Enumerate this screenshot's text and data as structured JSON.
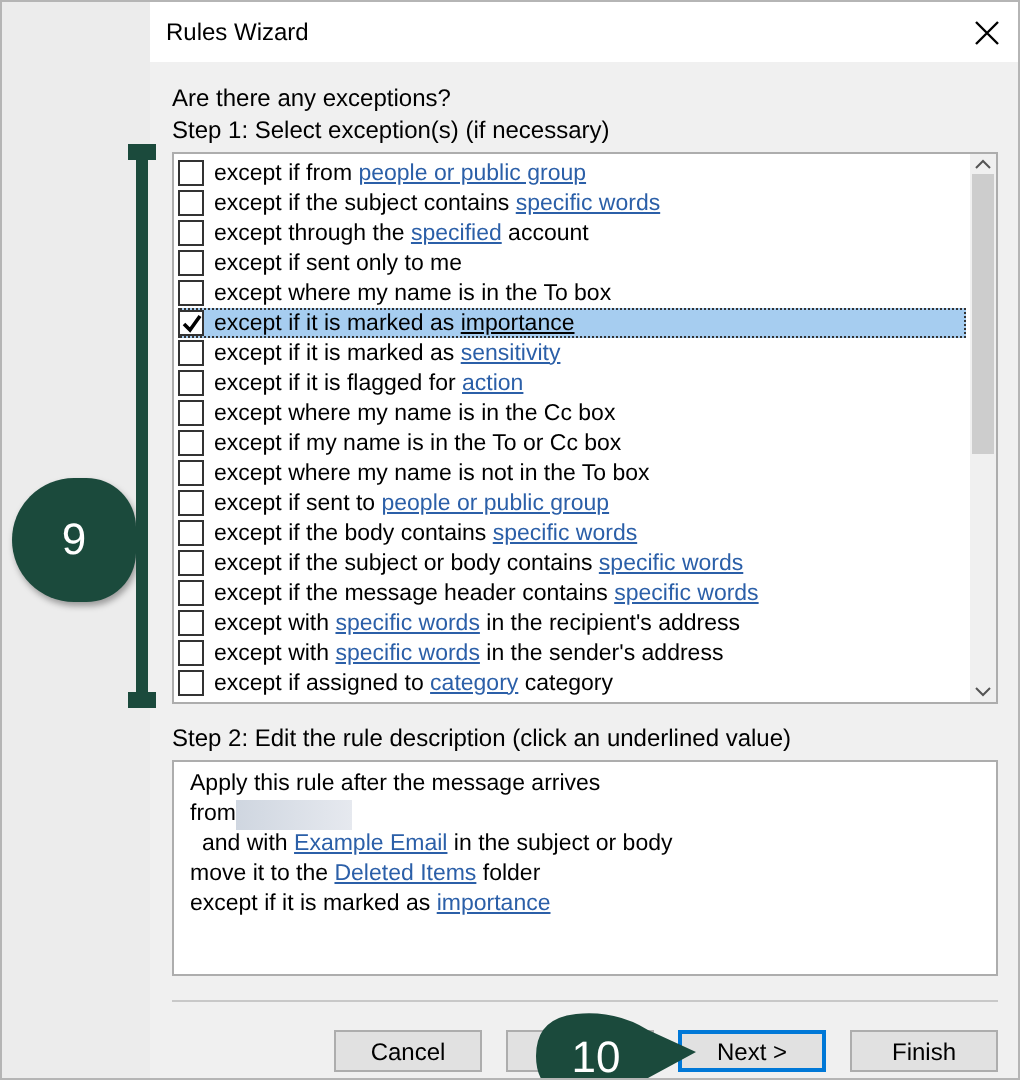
{
  "window": {
    "title": "Rules Wizard"
  },
  "question": "Are there any exceptions?",
  "step1_label": "Step 1: Select exception(s) (if necessary)",
  "exceptions": [
    {
      "checked": false,
      "selected": false,
      "parts": [
        {
          "kind": "text",
          "text": "except if from "
        },
        {
          "kind": "link",
          "text": "people or public group"
        }
      ]
    },
    {
      "checked": false,
      "selected": false,
      "parts": [
        {
          "kind": "text",
          "text": "except if the subject contains "
        },
        {
          "kind": "link",
          "text": "specific words"
        }
      ]
    },
    {
      "checked": false,
      "selected": false,
      "parts": [
        {
          "kind": "text",
          "text": "except through the "
        },
        {
          "kind": "link",
          "text": "specified"
        },
        {
          "kind": "text",
          "text": " account"
        }
      ]
    },
    {
      "checked": false,
      "selected": false,
      "parts": [
        {
          "kind": "text",
          "text": "except if sent only to me"
        }
      ]
    },
    {
      "checked": false,
      "selected": false,
      "parts": [
        {
          "kind": "text",
          "text": "except where my name is in the To box"
        }
      ]
    },
    {
      "checked": true,
      "selected": true,
      "parts": [
        {
          "kind": "text",
          "text": "except if it is marked as "
        },
        {
          "kind": "link",
          "text": "importance"
        }
      ]
    },
    {
      "checked": false,
      "selected": false,
      "parts": [
        {
          "kind": "text",
          "text": "except if it is marked as "
        },
        {
          "kind": "link",
          "text": "sensitivity"
        }
      ]
    },
    {
      "checked": false,
      "selected": false,
      "parts": [
        {
          "kind": "text",
          "text": "except if it is flagged for "
        },
        {
          "kind": "link",
          "text": "action"
        }
      ]
    },
    {
      "checked": false,
      "selected": false,
      "parts": [
        {
          "kind": "text",
          "text": "except where my name is in the Cc box"
        }
      ]
    },
    {
      "checked": false,
      "selected": false,
      "parts": [
        {
          "kind": "text",
          "text": "except if my name is in the To or Cc box"
        }
      ]
    },
    {
      "checked": false,
      "selected": false,
      "parts": [
        {
          "kind": "text",
          "text": "except where my name is not in the To box"
        }
      ]
    },
    {
      "checked": false,
      "selected": false,
      "parts": [
        {
          "kind": "text",
          "text": "except if sent to "
        },
        {
          "kind": "link",
          "text": "people or public group"
        }
      ]
    },
    {
      "checked": false,
      "selected": false,
      "parts": [
        {
          "kind": "text",
          "text": "except if the body contains "
        },
        {
          "kind": "link",
          "text": "specific words"
        }
      ]
    },
    {
      "checked": false,
      "selected": false,
      "parts": [
        {
          "kind": "text",
          "text": "except if the subject or body contains "
        },
        {
          "kind": "link",
          "text": "specific words"
        }
      ]
    },
    {
      "checked": false,
      "selected": false,
      "parts": [
        {
          "kind": "text",
          "text": "except if the message header contains "
        },
        {
          "kind": "link",
          "text": "specific words"
        }
      ]
    },
    {
      "checked": false,
      "selected": false,
      "parts": [
        {
          "kind": "text",
          "text": "except with "
        },
        {
          "kind": "link",
          "text": "specific words"
        },
        {
          "kind": "text",
          "text": " in the recipient's address"
        }
      ]
    },
    {
      "checked": false,
      "selected": false,
      "parts": [
        {
          "kind": "text",
          "text": "except with "
        },
        {
          "kind": "link",
          "text": "specific words"
        },
        {
          "kind": "text",
          "text": " in the sender's address"
        }
      ]
    },
    {
      "checked": false,
      "selected": false,
      "parts": [
        {
          "kind": "text",
          "text": "except if assigned to "
        },
        {
          "kind": "link",
          "text": "category"
        },
        {
          "kind": "text",
          "text": " category"
        }
      ]
    }
  ],
  "step2_label": "Step 2: Edit the rule description (click an underlined value)",
  "description": [
    {
      "indent": false,
      "parts": [
        {
          "kind": "text",
          "text": "Apply this rule after the message arrives"
        }
      ]
    },
    {
      "indent": false,
      "parts": [
        {
          "kind": "text",
          "text": "from"
        },
        {
          "kind": "redacted"
        }
      ]
    },
    {
      "indent": true,
      "parts": [
        {
          "kind": "text",
          "text": "and with "
        },
        {
          "kind": "link",
          "text": "Example Email"
        },
        {
          "kind": "text",
          "text": " in the subject or body"
        }
      ]
    },
    {
      "indent": false,
      "parts": [
        {
          "kind": "text",
          "text": "move it to the "
        },
        {
          "kind": "link",
          "text": "Deleted Items"
        },
        {
          "kind": "text",
          "text": " folder"
        }
      ]
    },
    {
      "indent": false,
      "parts": [
        {
          "kind": "text",
          "text": "except if it is marked as "
        },
        {
          "kind": "link",
          "text": "importance"
        }
      ]
    }
  ],
  "buttons": [
    {
      "kind": "normal",
      "label": "Cancel"
    },
    {
      "kind": "covered"
    },
    {
      "kind": "default",
      "label": "Next >"
    },
    {
      "kind": "normal",
      "label": "Finish"
    }
  ],
  "callouts": [
    {
      "label": "9"
    },
    {
      "label": "10"
    }
  ]
}
